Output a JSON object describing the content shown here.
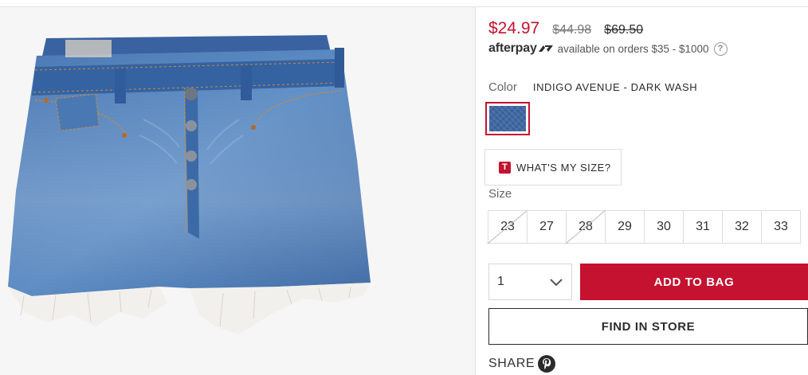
{
  "price": {
    "sale": "$24.97",
    "previous": "$44.98",
    "original": "$69.50"
  },
  "afterpay": {
    "logo_text": "afterpay",
    "message": "available on orders $35 - $1000",
    "help_icon": "question-circle-icon"
  },
  "color": {
    "label": "Color",
    "value": "INDIGO AVENUE - DARK WASH",
    "swatch_hex": "#3f69a4",
    "selected_border_hex": "#c41230"
  },
  "size_guide": {
    "badge": "T",
    "label": "WHAT'S MY SIZE?"
  },
  "size": {
    "label": "Size",
    "options": [
      {
        "value": "23",
        "available": false
      },
      {
        "value": "27",
        "available": true
      },
      {
        "value": "28",
        "available": false
      },
      {
        "value": "29",
        "available": true
      },
      {
        "value": "30",
        "available": true
      },
      {
        "value": "31",
        "available": true
      },
      {
        "value": "32",
        "available": true
      },
      {
        "value": "33",
        "available": true
      }
    ]
  },
  "quantity": {
    "value": "1",
    "icon": "chevron-down-icon"
  },
  "buttons": {
    "add_to_bag": "ADD TO BAG",
    "find_in_store": "FIND IN STORE"
  },
  "share": {
    "label": "SHARE",
    "icon": "pinterest-icon"
  },
  "colors": {
    "accent": "#c41230",
    "text": "#2b2b2b",
    "denim": "#3f69a4"
  }
}
